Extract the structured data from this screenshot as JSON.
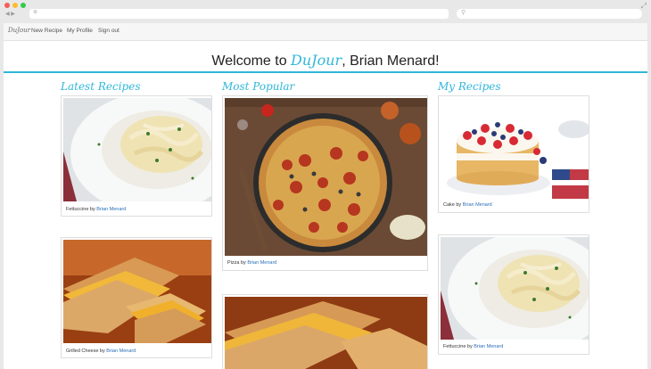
{
  "nav": {
    "brand": "DuJour",
    "links": [
      "New Recipe",
      "My Profile",
      "Sign out"
    ]
  },
  "welcome": {
    "prefix": "Welcome to ",
    "brand": "DuJour",
    "suffix": ", Brian Menard!"
  },
  "columns": {
    "latest": "Latest Recipes",
    "popular": "Most Popular",
    "mine": "My Recipes"
  },
  "cards": [
    {
      "title": "Fettuccine",
      "by": "by",
      "author": "Brian Menard"
    },
    {
      "title": "Grilled Cheese",
      "by": "by",
      "author": "Brian Menard"
    },
    {
      "title": "Pizza",
      "by": "by",
      "author": "Brian Menard"
    },
    {
      "title": "Cake",
      "by": "by",
      "author": "Brian Menard"
    },
    {
      "title": "Fettuccine",
      "by": "by",
      "author": "Brian Menard"
    }
  ],
  "icons": {
    "back": "back-arrow-icon",
    "forward": "forward-arrow-icon",
    "search": "search-icon",
    "expand": "expand-icon"
  },
  "colors": {
    "accent": "#2fb7d8",
    "link": "#2a6fb8"
  }
}
